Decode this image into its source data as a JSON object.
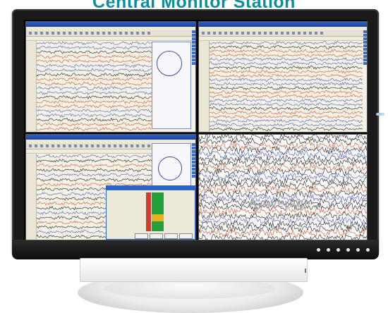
{
  "header": {
    "title": "Central Monitor Station"
  },
  "colors": {
    "title": "#0b8f9a",
    "app_titlebar": "#2d62c9",
    "trace_blue": "#4b5bc0",
    "trace_red": "#d0562e",
    "trace_black": "#222222",
    "compare_green": "#23a03a",
    "compare_red": "#d73a2b",
    "compare_yellow": "#e8b21e"
  },
  "screen": {
    "windows": [
      {
        "id": "eeg-window-1",
        "type": "eeg-viewer"
      },
      {
        "id": "eeg-window-2",
        "type": "eeg-viewer"
      },
      {
        "id": "eeg-window-3",
        "type": "eeg-viewer-with-dialog"
      },
      {
        "id": "eeg-window-4",
        "type": "average-traces",
        "overlay_label": "A-Average"
      }
    ]
  },
  "icons": {
    "montage": "head-montage-icon",
    "sidebar": "montage-selector-icon"
  }
}
